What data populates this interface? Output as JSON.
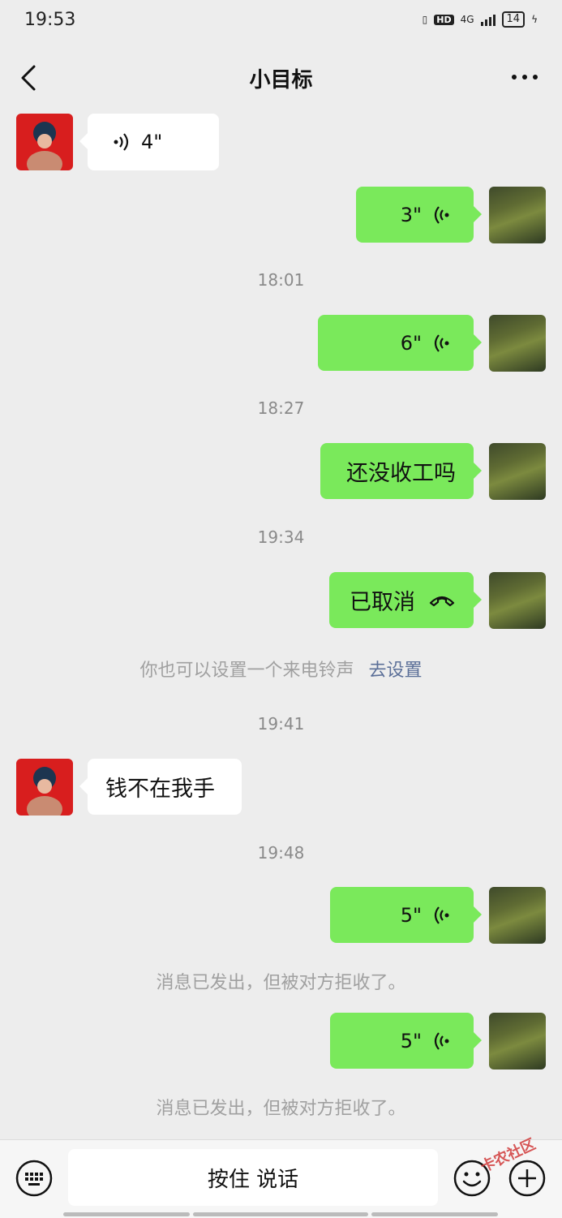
{
  "status": {
    "time": "19:53",
    "network": "4G",
    "hd": "HD",
    "battery": "14"
  },
  "header": {
    "title": "小目标"
  },
  "messages": {
    "m1": {
      "duration": "4\""
    },
    "m2": {
      "duration": "3\""
    },
    "t1": "18:01",
    "m3": {
      "duration": "6\""
    },
    "t2": "18:27",
    "m4": {
      "text": "还没收工吗"
    },
    "t3": "19:34",
    "m5": {
      "text": "已取消"
    },
    "sys1": {
      "text": "你也可以设置一个来电铃声",
      "link": "去设置"
    },
    "t4": "19:41",
    "m6": {
      "text": "钱不在我手"
    },
    "t5": "19:48",
    "m7": {
      "duration": "5\""
    },
    "sys2": "消息已发出，但被对方拒收了。",
    "m8": {
      "duration": "5\""
    },
    "sys3": "消息已发出，但被对方拒收了。"
  },
  "input": {
    "hold_to_talk": "按住 说话"
  },
  "watermark": "卡农社区",
  "colors": {
    "background": "#ededed",
    "outgoing_bubble": "#7ae95b",
    "incoming_bubble": "#ffffff",
    "link": "#5b6f98"
  }
}
